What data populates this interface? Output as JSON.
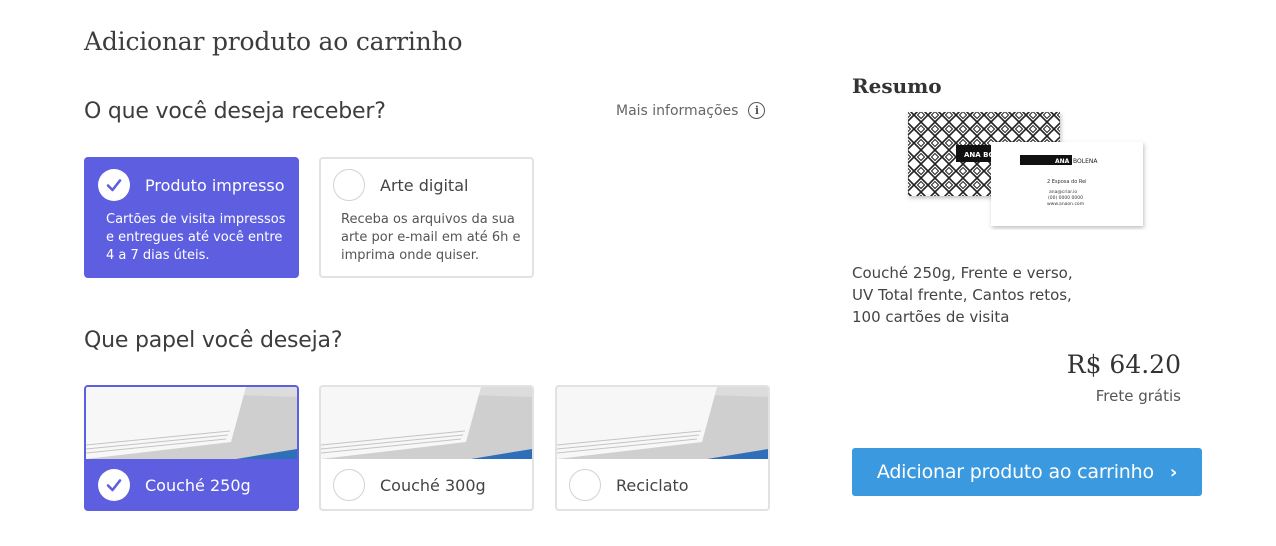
{
  "page": {
    "title": "Adicionar produto ao carrinho"
  },
  "delivery": {
    "heading": "O que você deseja receber?",
    "more_info": "Mais informações",
    "options": [
      {
        "label": "Produto impresso",
        "desc": "Cartões de visita impressos e entregues até você entre 4 a 7 dias úteis.",
        "selected": true
      },
      {
        "label": "Arte digital",
        "desc": "Receba os arquivos da sua arte por e-mail em até 6h e imprima onde quiser.",
        "selected": false
      }
    ]
  },
  "paper": {
    "heading": "Que papel você deseja?",
    "options": [
      {
        "label": "Couché 250g",
        "selected": true
      },
      {
        "label": "Couché 300g",
        "selected": false
      },
      {
        "label": "Reciclato",
        "selected": false
      }
    ]
  },
  "summary": {
    "title": "Resumo",
    "card_front_name": "ANA BOLENA",
    "card_back_name_1": "ANA",
    "card_back_name_2": "BOLENA",
    "card_back_role": "2 Esposa do Rei",
    "card_back_email": "ana@criar.io",
    "card_back_phone": "(00) 0000 0000",
    "card_back_web": "www.anaon.com",
    "desc_lines": [
      "Couché 250g, Frente e verso,",
      "UV Total frente, Cantos retos,",
      "100 cartões de visita"
    ],
    "price": "R$ 64.20",
    "shipping": "Frete grátis"
  },
  "cta": {
    "label": "Adicionar produto ao carrinho",
    "icon": "chevron-right-icon"
  },
  "colors": {
    "selected": "#5e5ee0",
    "cta": "#3b99e0"
  }
}
